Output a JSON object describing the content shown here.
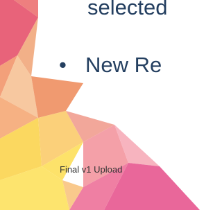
{
  "slide": {
    "continued_line": "selected",
    "bullet_marker": "•",
    "bullet_line": "New Re",
    "footer": "Final v1 Upload"
  },
  "theme": {
    "text_color": "#243f60",
    "footer_color": "#333333",
    "decoration_colors": [
      "#e8637a",
      "#f0a070",
      "#f7c48a",
      "#fde26a",
      "#f5a9b8",
      "#e65c8a",
      "#f7b79a"
    ]
  }
}
